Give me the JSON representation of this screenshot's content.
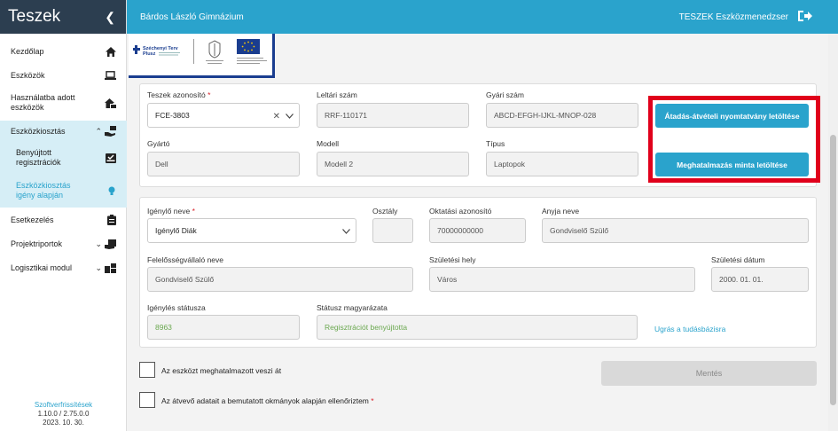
{
  "sidebar": {
    "title": "Teszek",
    "items": [
      {
        "label": "Kezdőlap",
        "icon": "home-icon"
      },
      {
        "label": "Eszközök",
        "icon": "laptop-icon"
      },
      {
        "label": "Használatba adott eszközök",
        "icon": "home-device-icon"
      },
      {
        "label": "Eszközkiosztás",
        "icon": "hand-device-icon"
      },
      {
        "label": "Benyújtott regisztrációk",
        "icon": "inbox-check-icon"
      },
      {
        "label": "Eszközkiosztás igény alapján",
        "icon": "lightbulb-icon"
      },
      {
        "label": "Esetkezelés",
        "icon": "clipboard-icon"
      },
      {
        "label": "Projektriportok",
        "icon": "report-icon"
      },
      {
        "label": "Logisztikai modul",
        "icon": "logistics-icon"
      }
    ],
    "footer": {
      "link": "Szoftverfrissítések",
      "version": "1.10.0 / 2.75.0.0",
      "date": "2023. 10. 30."
    }
  },
  "topbar": {
    "school": "Bárdos László Gimnázium",
    "app_title": "TESZEK Eszközmenedzser"
  },
  "logos": {
    "logo1_line1": "Széchenyi Terv",
    "logo1_line2": "Plusz"
  },
  "device": {
    "id_label": "Teszek azonosító",
    "id_value": "FCE-3803",
    "inventory_label": "Leltári szám",
    "inventory_value": "RRF-110171",
    "serial_label": "Gyári szám",
    "serial_value": "ABCD-EFGH-IJKL-MNOP-028",
    "maker_label": "Gyártó",
    "maker_value": "Dell",
    "model_label": "Modell",
    "model_value": "Modell 2",
    "type_label": "Típus",
    "type_value": "Laptopok",
    "btn_handover": "Átadás-átvételi nyomtatvány letöltése",
    "btn_authorization": "Meghatalmazás minta letöltése"
  },
  "requester": {
    "name_label": "Igénylő neve",
    "name_value": "Igénylő Diák",
    "class_label": "Osztály",
    "class_value": "",
    "edu_id_label": "Oktatási azonosító",
    "edu_id_value": "70000000000",
    "mother_label": "Anyja neve",
    "mother_value": "Gondviselő Szülő",
    "guardian_label": "Felelősségvállaló neve",
    "guardian_value": "Gondviselő Szülő",
    "birthplace_label": "Születési hely",
    "birthplace_value": "Város",
    "birthdate_label": "Születési dátum",
    "birthdate_value": "2000. 01. 01.",
    "status_label": "Igénylés státusza",
    "status_value": "8963",
    "status_desc_label": "Státusz magyarázata",
    "status_desc_value": "Regisztrációt benyújtotta",
    "kb_link": "Ugrás a tudásbázisra"
  },
  "footer_form": {
    "check1": "Az eszközt meghatalmazott veszi át",
    "check2": "Az átvevő adatait a bemutatott okmányok alapján ellenőriztem",
    "save": "Mentés"
  }
}
